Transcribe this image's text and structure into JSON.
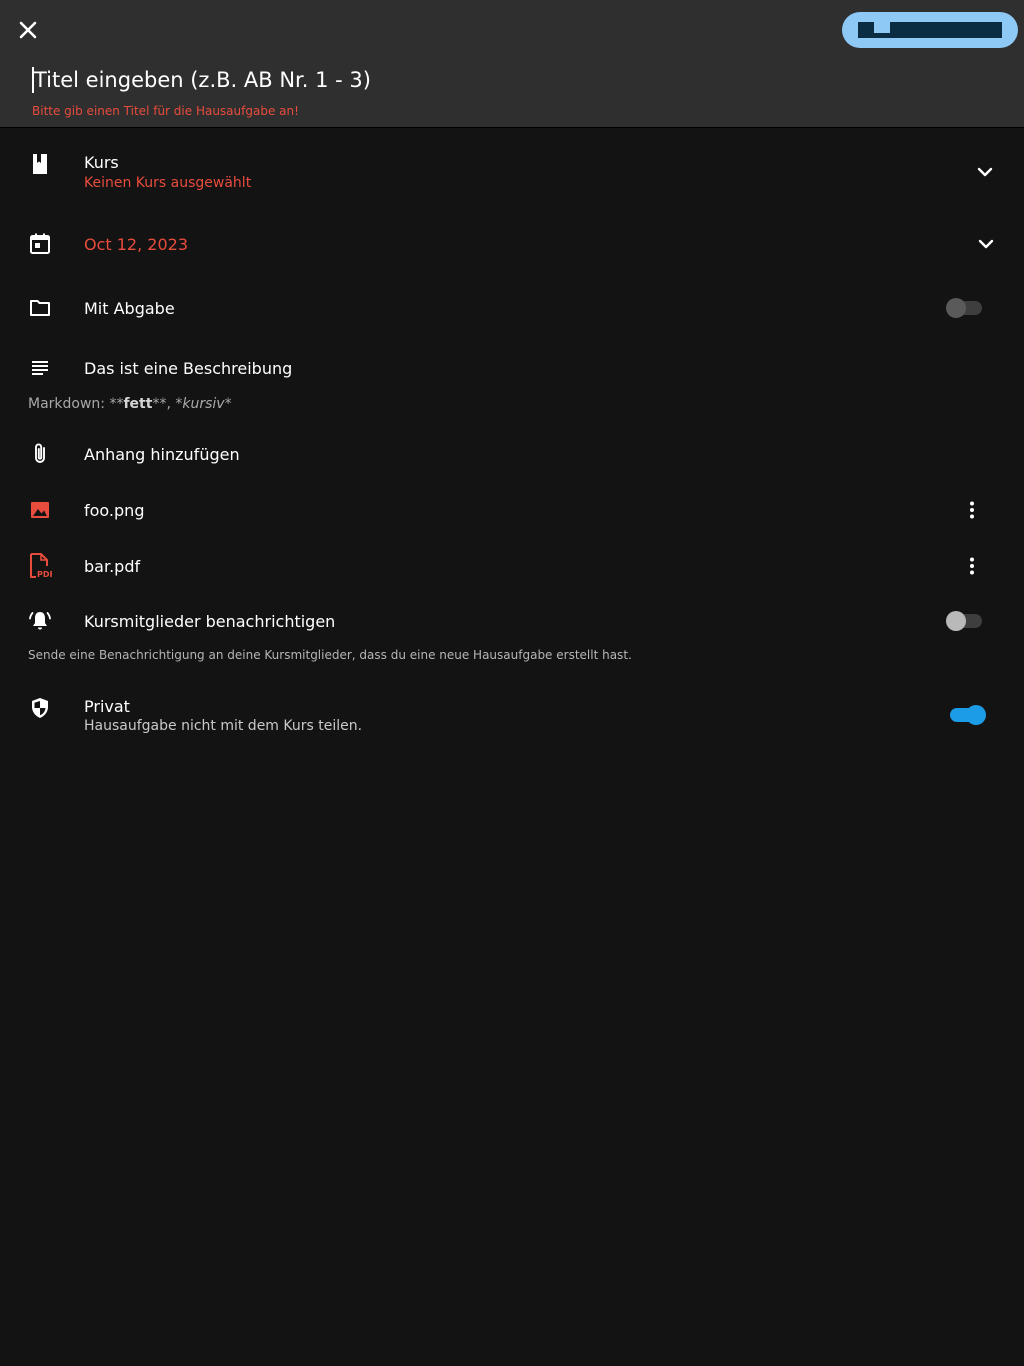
{
  "header": {
    "title_placeholder": "Titel eingeben (z.B. AB Nr. 1 - 3)",
    "title_error": "Bitte gib einen Titel für die Hausaufgabe an!",
    "save_button_color": "#8ec9f5"
  },
  "course": {
    "label": "Kurs",
    "value": "Keinen Kurs ausgewählt"
  },
  "due_date": {
    "value": "Oct 12, 2023"
  },
  "submission": {
    "label": "Mit Abgabe",
    "enabled": false
  },
  "description": {
    "text": "Das ist eine Beschreibung",
    "markdown_hint_prefix": "Markdown: **",
    "markdown_bold": "fett",
    "markdown_hint_middle": "**, *",
    "markdown_italic": "kursiv",
    "markdown_hint_suffix": "*"
  },
  "attachments": {
    "add_label": "Anhang hinzufügen",
    "items": [
      {
        "name": "foo.png",
        "icon": "image-icon"
      },
      {
        "name": "bar.pdf",
        "icon": "pdf-icon"
      }
    ]
  },
  "notify": {
    "label": "Kursmitglieder benachrichtigen",
    "hint": "Sende eine Benachrichtigung an deine Kursmitglieder, dass du eine neue Hausaufgabe erstellt hast.",
    "enabled": false
  },
  "private": {
    "label": "Privat",
    "sub": "Hausaufgabe nicht mit dem Kurs teilen.",
    "enabled": true
  },
  "colors": {
    "background": "#131313",
    "header": "#2f2f2f",
    "error": "#e84c3d",
    "accent": "#1c9be6"
  }
}
